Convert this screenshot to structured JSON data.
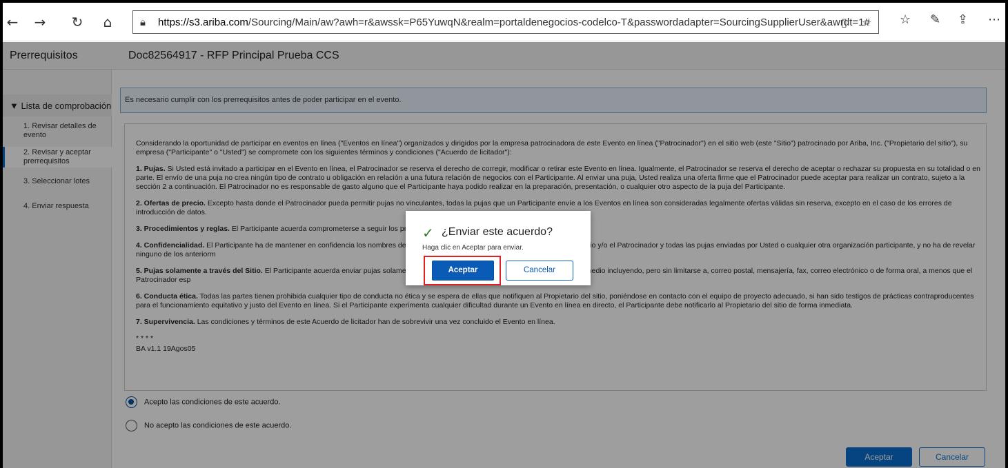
{
  "browser": {
    "back": "←",
    "forward": "→",
    "refresh": "↻",
    "home": "⌂",
    "url_host": "https://s3.ariba.com",
    "url_path": "/Sourcing/Main/aw?awh=r&awssk=P65YuwqN&realm=portaldenegocios-codelco-T&passwordadapter=SourcingSupplierUser&awrdt=1#",
    "icons": [
      "lock-icon",
      "reading-view-icon",
      "favorite-star-icon",
      "favorites-list-icon",
      "pen-icon",
      "share-icon",
      "more-icon"
    ]
  },
  "header": {
    "left_title": "Prerrequisitos",
    "doc_title": "Doc82564917 - RFP Principal Prueba CCS"
  },
  "sidebar": {
    "header": "▼ Lista de comprobación",
    "items": [
      {
        "label": "1.  Revisar detalles de evento"
      },
      {
        "label": "2.  Revisar y aceptar prerrequisitos"
      },
      {
        "label": "3.  Seleccionar lotes"
      },
      {
        "label": "4.  Enviar respuesta"
      }
    ]
  },
  "main": {
    "info": "Es necesario cumplir con los prerrequisitos antes de poder participar en el evento.",
    "intro": "Considerando la oportunidad de participar en eventos en línea (\"Eventos en línea\") organizados y dirigidos por la empresa patrocinadora de este Evento en línea (\"Patrocinador\") en el sitio web (este \"Sitio\") patrocinado por Ariba, Inc. (\"Propietario del sitio\"), su empresa (\"Participante\" o \"Usted\") se compromete con los siguientes términos y condiciones (\"Acuerdo de licitador\"):",
    "clauses": [
      {
        "title": "1. Pujas.",
        "text": " Si Usted está invitado a participar en el Evento en línea, el Patrocinador se reserva el derecho de corregir, modificar o retirar este Evento en línea. Igualmente, el Patrocinador se reserva el derecho de aceptar o rechazar su propuesta en su totalidad o en parte. El envío de una puja no crea ningún tipo de contrato u obligación en relación a una futura relación de negocios con el Participante. Al enviar una puja, Usted realiza una oferta firme que el Patrocinador puede aceptar para realizar un contrato, sujeto a la sección 2 a continuación. El Patrocinador no es responsable de gasto alguno que el Participante haya podido realizar en la preparación, presentación, o cualquier otro aspecto de la puja del Participante."
      },
      {
        "title": "2. Ofertas de precio.",
        "text": " Excepto hasta donde el Patrocinador pueda permitir pujas no vinculantes, todas la pujas que un Participante envíe a los Eventos en línea son consideradas legalmente ofertas válidas sin reserva, excepto en el caso de los errores de introducción de datos."
      },
      {
        "title": "3. Procedimientos y reglas.",
        "text": " El Participante acuerda comprometerse a seguir los pro                                                                                                              nador."
      },
      {
        "title": "4. Confidencialidad.",
        "text": " El Participante ha de mantener en confidencia los nombres de                                                                                        otros materiales confidenciales proporcionados por el Sitio y/o el Patrocinador y todas las pujas enviadas por Usted o cualquier otra organización participante, y no ha de revelar ninguno de los anteriorm"
      },
      {
        "title": "5. Pujas solamente a través del Sitio.",
        "text": " El Participante acuerda enviar pujas solamer                                                                                o por el Sitio y no enviar pujas a través de ningún otro medio incluyendo, pero sin limitarse a, correo postal, mensajería, fax, correo electrónico o de forma oral, a menos que el Patrocinador esp"
      },
      {
        "title": "6. Conducta ética.",
        "text": " Todas las partes tienen prohibida cualquier tipo de conducta no ética y se espera de ellas que notifiquen al Propietario del sitio, poniéndose en contacto con el equipo de proyecto adecuado, si han sido testigos de prácticas contraproducentes para el funcionamiento equitativo y justo del Evento en línea. Si el Participante experimenta cualquier dificultad durante un Evento en línea en directo, el Participante debe notificarlo al Propietario del sitio de forma inmediata."
      },
      {
        "title": "7. Supervivencia.",
        "text": " Las condiciones y términos de este Acuerdo de licitador han de sobrevivir una vez concluido el Evento en línea."
      }
    ],
    "stars": "* * * *",
    "version": "BA v1.1 19Agos05",
    "accept_label": "Acepto las condiciones de este acuerdo.",
    "reject_label": "No acepto las condiciones de este acuerdo.",
    "accept_button": "Aceptar",
    "cancel_button": "Cancelar"
  },
  "dialog": {
    "title": "¿Enviar este acuerdo?",
    "message": "Haga clic en Aceptar para enviar.",
    "ok": "Aceptar",
    "cancel": "Cancelar"
  },
  "colors": {
    "primary": "#0a6ed1",
    "highlight": "#e02020",
    "check": "#2b7d2b"
  }
}
